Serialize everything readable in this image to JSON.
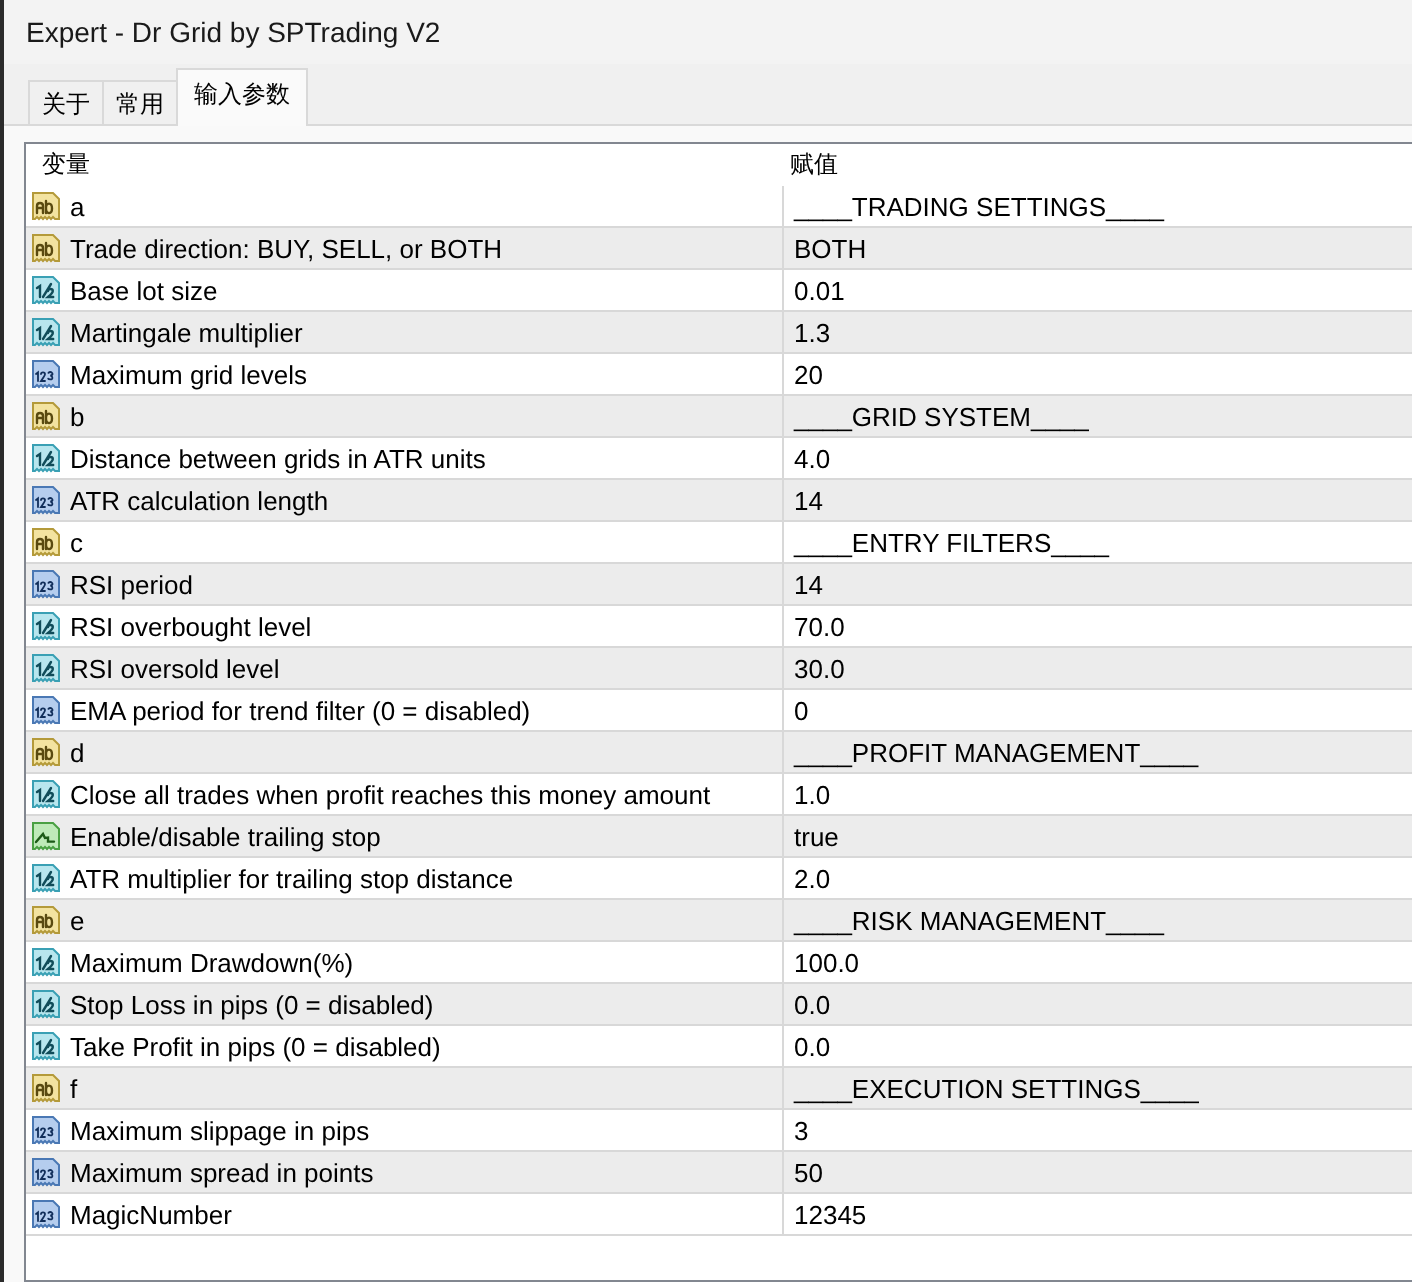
{
  "window": {
    "title": "Expert - Dr Grid by SPTrading V2"
  },
  "tabs": [
    {
      "label": "关于",
      "selected": false
    },
    {
      "label": "常用",
      "selected": false
    },
    {
      "label": "输入参数",
      "selected": true
    }
  ],
  "table": {
    "columns": [
      "变量",
      "赋值"
    ],
    "rows": [
      {
        "kind": "string",
        "name": "a",
        "value": "____TRADING SETTINGS____"
      },
      {
        "kind": "string",
        "name": "Trade direction: BUY, SELL, or BOTH",
        "value": "BOTH"
      },
      {
        "kind": "double",
        "name": "Base lot size",
        "value": "0.01"
      },
      {
        "kind": "double",
        "name": "Martingale multiplier",
        "value": "1.3"
      },
      {
        "kind": "integer",
        "name": "Maximum grid levels",
        "value": "20"
      },
      {
        "kind": "string",
        "name": "b",
        "value": "____GRID SYSTEM____"
      },
      {
        "kind": "double",
        "name": "Distance between grids in ATR units",
        "value": "4.0"
      },
      {
        "kind": "integer",
        "name": "ATR calculation length",
        "value": "14"
      },
      {
        "kind": "string",
        "name": "c",
        "value": "____ENTRY FILTERS____"
      },
      {
        "kind": "integer",
        "name": "RSI period",
        "value": "14"
      },
      {
        "kind": "double",
        "name": "RSI overbought level",
        "value": "70.0"
      },
      {
        "kind": "double",
        "name": "RSI oversold level",
        "value": "30.0"
      },
      {
        "kind": "integer",
        "name": "EMA period for trend filter (0 = disabled)",
        "value": "0"
      },
      {
        "kind": "string",
        "name": "d",
        "value": "____PROFIT MANAGEMENT____"
      },
      {
        "kind": "double",
        "name": "Close all trades when profit reaches this money amount",
        "value": "1.0"
      },
      {
        "kind": "boolean",
        "name": "Enable/disable trailing stop",
        "value": "true"
      },
      {
        "kind": "double",
        "name": "ATR multiplier for trailing stop distance",
        "value": "2.0"
      },
      {
        "kind": "string",
        "name": "e",
        "value": "____RISK MANAGEMENT____"
      },
      {
        "kind": "double",
        "name": "Maximum Drawdown(%)",
        "value": "100.0"
      },
      {
        "kind": "double",
        "name": "Stop Loss in pips (0 = disabled)",
        "value": "0.0"
      },
      {
        "kind": "double",
        "name": "Take Profit in pips (0 = disabled)",
        "value": "0.0"
      },
      {
        "kind": "string",
        "name": "f",
        "value": "____EXECUTION SETTINGS____"
      },
      {
        "kind": "integer",
        "name": "Maximum slippage in pips",
        "value": "3"
      },
      {
        "kind": "integer",
        "name": "Maximum spread in points",
        "value": "50"
      },
      {
        "kind": "integer",
        "name": "MagicNumber",
        "value": "12345"
      }
    ]
  }
}
